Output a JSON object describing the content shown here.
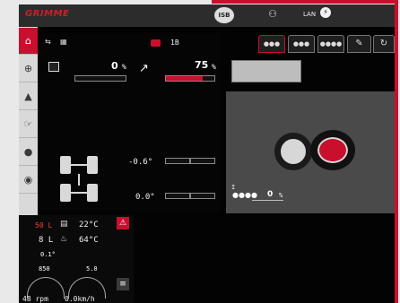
{
  "top_bar": {
    "logo_text": "GRIMME",
    "iso_label": "ISB",
    "lan_label": "LAN"
  },
  "left_panel": {
    "ratio_label": "1B",
    "left_value": "0",
    "left_unit": "%",
    "left_fraction": 0.0,
    "right_value": "75",
    "right_unit": "%",
    "right_fraction": 0.75,
    "angle_1": "-0.6",
    "angle_2": "0.0",
    "angle_unit": "°"
  },
  "right_panel": {
    "counter_label": "I",
    "counter_value": "0",
    "counter_unit": "%"
  },
  "bottom_panel": {
    "row1_value": "50",
    "row1_unit": "L",
    "row1_temp": "22",
    "row1_temp_unit": "°C",
    "row2_value": "8",
    "row2_unit": "L",
    "row2_temp": "64",
    "row2_temp_unit": "°C",
    "row3_value": "0.1",
    "row3_unit": "°",
    "row4_left": "850",
    "row4_right": "5.0",
    "rpm_value": "48",
    "rpm_unit": "rpm",
    "speed_value": "0.0",
    "speed_unit": "km/h"
  },
  "colors": {
    "accent": "#c8102e",
    "background": "#030303",
    "panel_gray": "#4a4a4a"
  }
}
